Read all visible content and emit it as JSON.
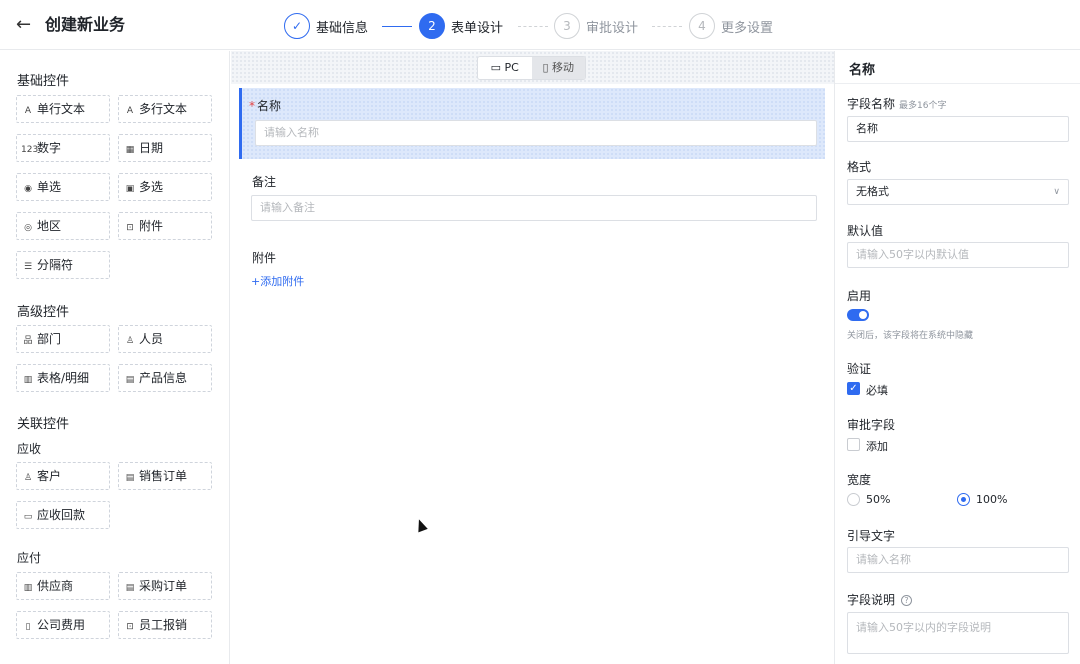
{
  "header": {
    "back_icon": "←",
    "title": "创建新业务",
    "steps": [
      {
        "marker": "✓",
        "label": "基础信息",
        "state": "done"
      },
      {
        "marker": "2",
        "label": "表单设计",
        "state": "active"
      },
      {
        "marker": "3",
        "label": "审批设计",
        "state": "todo"
      },
      {
        "marker": "4",
        "label": "更多设置",
        "state": "todo"
      }
    ]
  },
  "palette": {
    "basic_title": "基础控件",
    "basic": [
      {
        "icon": "A",
        "label": "单行文本"
      },
      {
        "icon": "A",
        "label": "多行文本"
      },
      {
        "icon": "123",
        "label": "数字"
      },
      {
        "icon": "▦",
        "label": "日期"
      },
      {
        "icon": "◉",
        "label": "单选"
      },
      {
        "icon": "▣",
        "label": "多选"
      },
      {
        "icon": "◎",
        "label": "地区"
      },
      {
        "icon": "⊡",
        "label": "附件"
      },
      {
        "icon": "☰",
        "label": "分隔符"
      }
    ],
    "advanced_title": "高级控件",
    "advanced": [
      {
        "icon": "品",
        "label": "部门"
      },
      {
        "icon": "♙",
        "label": "人员"
      },
      {
        "icon": "▥",
        "label": "表格/明细"
      },
      {
        "icon": "▤",
        "label": "产品信息"
      }
    ],
    "related_title": "关联控件",
    "receivable_title": "应收",
    "receivable": [
      {
        "icon": "♙",
        "label": "客户"
      },
      {
        "icon": "▤",
        "label": "销售订单"
      },
      {
        "icon": "▭",
        "label": "应收回款"
      }
    ],
    "payable_title": "应付",
    "payable": [
      {
        "icon": "▥",
        "label": "供应商"
      },
      {
        "icon": "▤",
        "label": "采购订单"
      },
      {
        "icon": "▯",
        "label": "公司费用"
      },
      {
        "icon": "⊡",
        "label": "员工报销"
      }
    ]
  },
  "canvas": {
    "modes": [
      {
        "icon": "▭",
        "label": "PC"
      },
      {
        "icon": "▯",
        "label": "移动"
      }
    ],
    "fields": {
      "name": {
        "required": "*",
        "label": "名称",
        "placeholder": "请输入名称"
      },
      "remark": {
        "label": "备注",
        "placeholder": "请输入备注"
      },
      "attachment": {
        "label": "附件",
        "link": "+添加附件"
      }
    }
  },
  "props": {
    "title": "名称",
    "field_name_label": "字段名称",
    "field_name_hint": "最多16个字",
    "field_name_value": "名称",
    "format_label": "格式",
    "format_value": "无格式",
    "default_label": "默认值",
    "default_placeholder": "请输入50字以内默认值",
    "enable_label": "启用",
    "enable_on": true,
    "enable_hint": "关闭后，该字段将在系统中隐藏",
    "validation_label": "验证",
    "required_option": "必填",
    "required_checked": true,
    "approval_label": "审批字段",
    "approval_option": "添加",
    "approval_checked": false,
    "width_label": "宽度",
    "width_options": [
      "50%",
      "100%"
    ],
    "width_selected": "100%",
    "guide_label": "引导文字",
    "guide_placeholder": "请输入名称",
    "desc_label": "字段说明",
    "desc_help": "?",
    "desc_placeholder": "请输入50字以内的字段说明"
  },
  "colors": {
    "accent": "#2f6bf0",
    "required": "#e54545"
  }
}
